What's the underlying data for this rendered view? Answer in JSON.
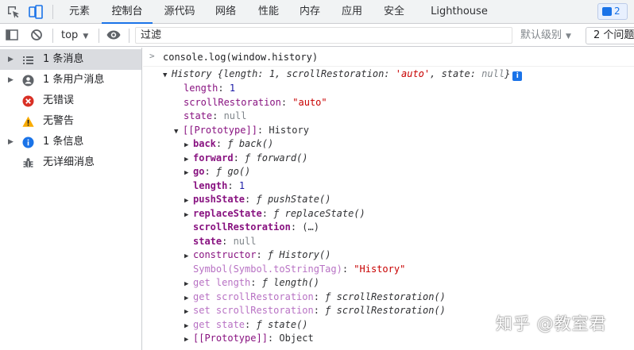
{
  "tabs": [
    {
      "label": "元素"
    },
    {
      "label": "控制台"
    },
    {
      "label": "源代码"
    },
    {
      "label": "网络"
    },
    {
      "label": "性能"
    },
    {
      "label": "内存"
    },
    {
      "label": "应用"
    },
    {
      "label": "安全"
    },
    {
      "label": "Lighthouse"
    }
  ],
  "active_tab": "控制台",
  "issues_badge": "2",
  "toolbar": {
    "context": "top",
    "filter_placeholder": "过滤",
    "levels": "默认级别",
    "issues": "2 个问题"
  },
  "sidebar": {
    "items": [
      {
        "label": "1 条消息",
        "icon": "list-icon"
      },
      {
        "label": "1 条用户消息",
        "icon": "user-icon"
      },
      {
        "label": "无错误",
        "icon": "error-icon"
      },
      {
        "label": "无警告",
        "icon": "warning-icon"
      },
      {
        "label": "1 条信息",
        "icon": "info-icon"
      },
      {
        "label": "无详细消息",
        "icon": "bug-icon"
      }
    ]
  },
  "console": {
    "command": "console.log(window.history)",
    "summary": {
      "head": "History ",
      "body": "{length: 1, scrollRestoration: ",
      "sr": "'auto'",
      "mid": ", state: ",
      "state": "null",
      "tail": "}"
    },
    "props": {
      "length_key": "length",
      "length_val": "1",
      "sr_key": "scrollRestoration",
      "sr_val": "\"auto\"",
      "state_key": "state",
      "state_val": "null"
    },
    "proto": {
      "key": "[[Prototype]]",
      "val": "History"
    },
    "methods": [
      {
        "key": "back",
        "fn": "back()"
      },
      {
        "key": "forward",
        "fn": "forward()"
      },
      {
        "key": "go",
        "fn": "go()"
      }
    ],
    "proto_length": {
      "key": "length",
      "val": "1"
    },
    "methods2": [
      {
        "key": "pushState",
        "fn": "pushState()"
      },
      {
        "key": "replaceState",
        "fn": "replaceState()"
      }
    ],
    "proto_sr": {
      "key": "scrollRestoration",
      "val": "(…)"
    },
    "proto_state": {
      "key": "state",
      "val": "null"
    },
    "constructor": {
      "key": "constructor",
      "fn": "History()"
    },
    "symbol": {
      "key": "Symbol(Symbol.toStringTag)",
      "val": "\"History\""
    },
    "accessors": [
      {
        "key": "get length",
        "fn": "length()"
      },
      {
        "key": "get scrollRestoration",
        "fn": "scrollRestoration()"
      },
      {
        "key": "set scrollRestoration",
        "fn": "scrollRestoration()"
      },
      {
        "key": "get state",
        "fn": "state()"
      }
    ],
    "proto2": {
      "key": "[[Prototype]]",
      "val": "Object"
    },
    "f": "ƒ"
  },
  "watermark": "知乎 @教室君",
  "colors": {
    "accent": "#1a73e8",
    "error": "#d93025",
    "warning": "#f9ab00",
    "key": "#881280",
    "string": "#c80000",
    "number": "#1a1aa6"
  }
}
